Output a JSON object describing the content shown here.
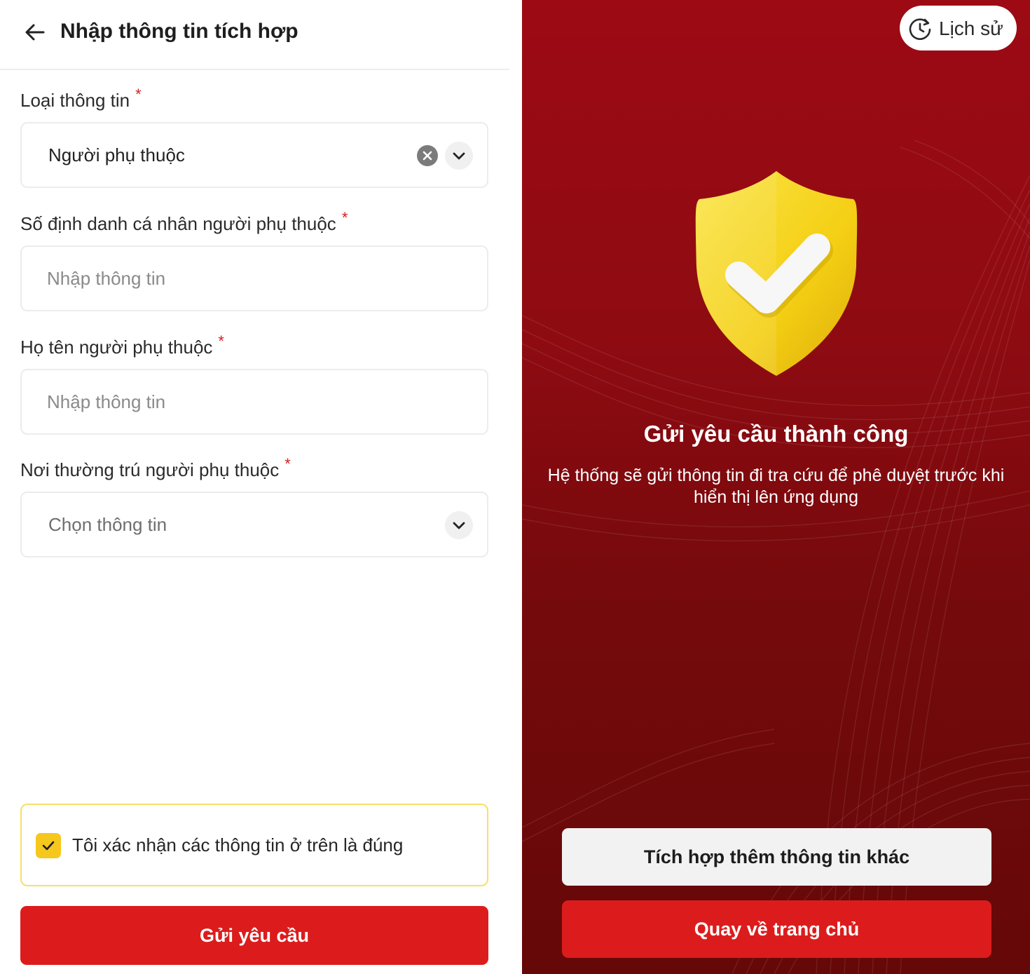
{
  "form": {
    "header": {
      "title": "Nhập thông tin tích hợp",
      "back_icon": "arrow-left-icon"
    },
    "required_mark": "*",
    "fields": [
      {
        "label": "Loại thông tin",
        "value": "Người phụ thuộc",
        "type": "select"
      },
      {
        "label": "Số định danh cá nhân người phụ thuộc",
        "placeholder": "Nhập thông tin",
        "type": "text"
      },
      {
        "label": "Họ tên người phụ thuộc",
        "placeholder": "Nhập thông tin",
        "type": "text"
      },
      {
        "label": "Nơi thường trú người phụ thuộc",
        "placeholder": "Chọn thông tin",
        "type": "select"
      }
    ],
    "confirm": {
      "label": "Tôi xác nhận các thông tin ở trên là đúng",
      "checked": true
    },
    "submit_label": "Gửi yêu cầu"
  },
  "result": {
    "history_label": "Lịch sử",
    "title": "Gửi yêu cầu thành công",
    "description": "Hệ thống sẽ gửi thông tin đi tra cứu để phê duyệt trước khi hiển thị lên ứng dụng",
    "more_button": "Tích hợp thêm thông tin khác",
    "home_button": "Quay về trang chủ"
  },
  "colors": {
    "primary_red": "#dc1c1c",
    "panel_red": "#8e0b12",
    "accent_yellow": "#f6c71c",
    "required_red": "#d41f1f"
  }
}
